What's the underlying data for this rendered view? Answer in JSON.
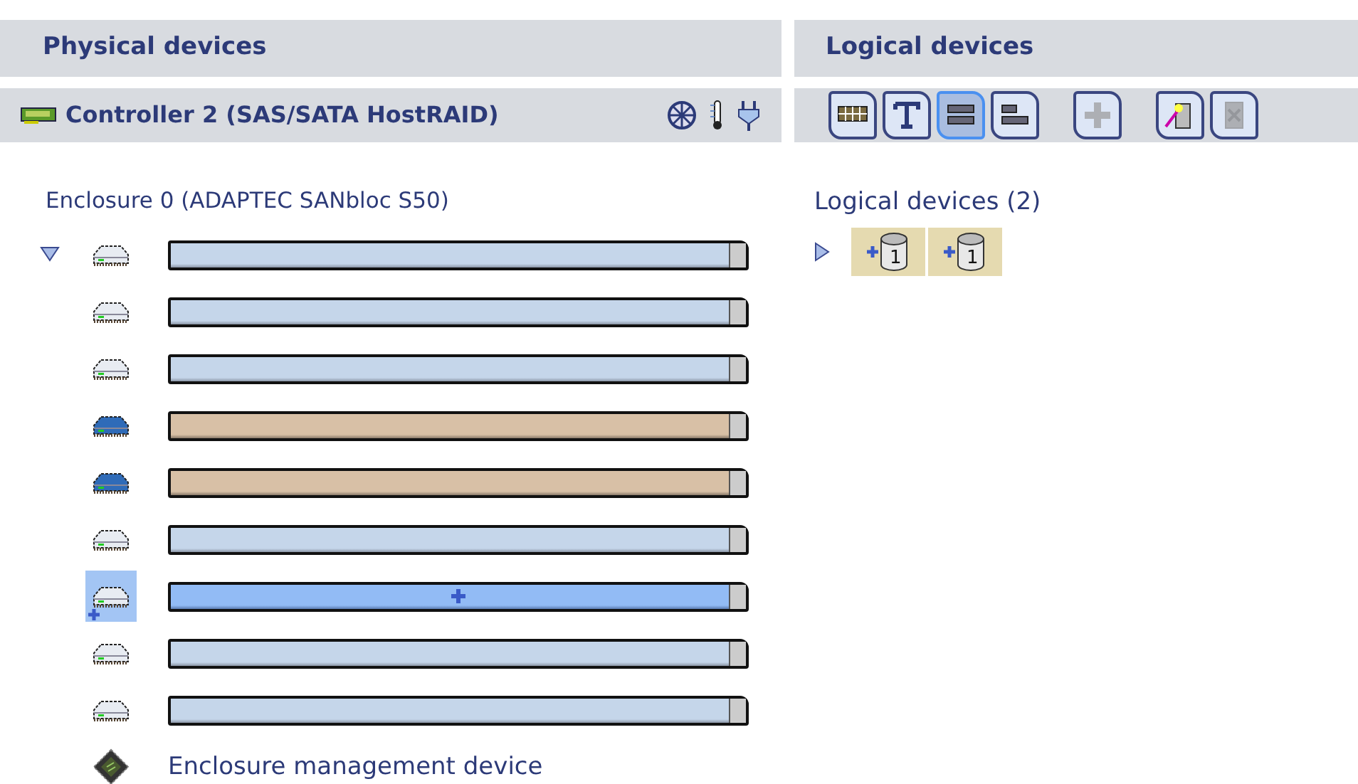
{
  "physical_panel": {
    "title": "Physical devices",
    "controller": {
      "name": "Controller 2 (SAS/SATA HostRAID)",
      "status_icons": [
        {
          "kind": "fan"
        },
        {
          "kind": "temperature"
        },
        {
          "kind": "power"
        }
      ]
    },
    "enclosure": {
      "title": "Enclosure 0 (ADAPTEC SANbloc S50)",
      "expanded": true,
      "disks": [
        {
          "kind": "available",
          "selected": false
        },
        {
          "kind": "available",
          "selected": false
        },
        {
          "kind": "available",
          "selected": false
        },
        {
          "kind": "in-use",
          "selected": false
        },
        {
          "kind": "in-use",
          "selected": false
        },
        {
          "kind": "available",
          "selected": false
        },
        {
          "kind": "available",
          "selected": true
        },
        {
          "kind": "available",
          "selected": false
        },
        {
          "kind": "available",
          "selected": false
        }
      ],
      "management_device": "Enclosure management device"
    }
  },
  "logical_panel": {
    "title": "Logical devices",
    "toolbar": [
      {
        "kind": "grid",
        "selected": false,
        "disabled": false
      },
      {
        "kind": "text",
        "selected": false,
        "disabled": false
      },
      {
        "kind": "full",
        "selected": true,
        "disabled": false
      },
      {
        "kind": "partial",
        "selected": false,
        "disabled": false
      },
      {
        "kind": "add",
        "selected": false,
        "disabled": true
      },
      {
        "kind": "wizard",
        "selected": false,
        "disabled": false
      },
      {
        "kind": "delete",
        "selected": false,
        "disabled": true
      }
    ],
    "group": {
      "title": "Logical devices (2)",
      "expanded": false,
      "devices": [
        {
          "label": "1"
        },
        {
          "label": "1"
        }
      ]
    }
  }
}
